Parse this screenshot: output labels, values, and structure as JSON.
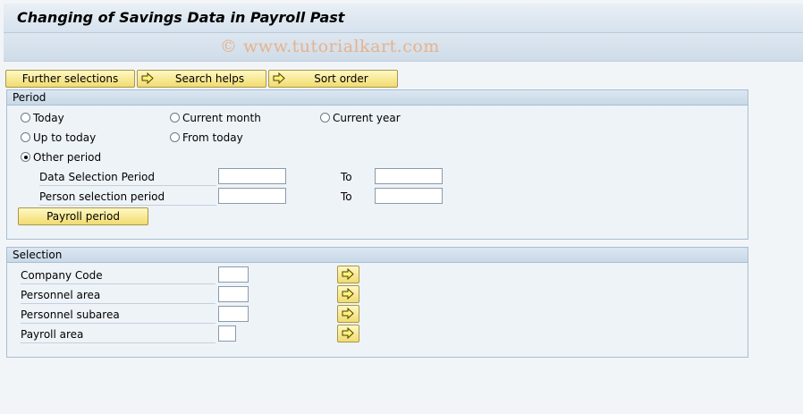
{
  "window": {
    "title": "Changing of Savings Data in Payroll Past",
    "watermark": "© www.tutorialkart.com"
  },
  "toolbar": {
    "further_selections": "Further selections",
    "search_helps": "Search helps",
    "sort_order": "Sort order"
  },
  "period": {
    "heading": "Period",
    "options": {
      "today": "Today",
      "current_month": "Current month",
      "current_year": "Current year",
      "up_to_today": "Up to today",
      "from_today": "From today",
      "other_period": "Other period"
    },
    "selected": "other_period",
    "fields": {
      "data_selection": {
        "label": "Data Selection Period",
        "from": "",
        "to_label": "To",
        "to": ""
      },
      "person_selection": {
        "label": "Person selection period",
        "from": "",
        "to_label": "To",
        "to": ""
      }
    },
    "payroll_period_button": "Payroll period"
  },
  "selection": {
    "heading": "Selection",
    "fields": {
      "company_code": {
        "label": "Company Code",
        "value": ""
      },
      "personnel_area": {
        "label": "Personnel area",
        "value": ""
      },
      "personnel_subarea": {
        "label": "Personnel subarea",
        "value": ""
      },
      "payroll_area": {
        "label": "Payroll area",
        "value": ""
      }
    }
  },
  "icons": {
    "arrow": "multiple-selection-arrow-icon",
    "accent": "#f1dc6f"
  }
}
